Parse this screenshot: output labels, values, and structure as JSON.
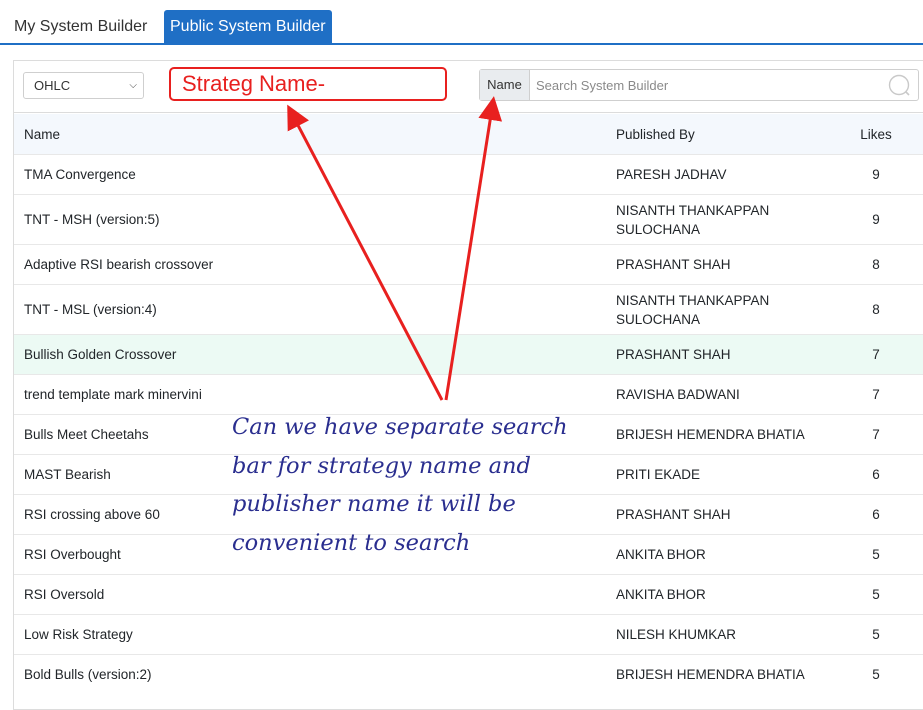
{
  "tabs": [
    {
      "label": "My System Builder",
      "active": false
    },
    {
      "label": "Public System Builder",
      "active": true
    }
  ],
  "filter": {
    "select_value": "OHLC",
    "annotation_box_text": "Strateg Name-",
    "search_label": "Name",
    "search_placeholder": "Search System Builder",
    "search_value": ""
  },
  "table": {
    "headers": {
      "name": "Name",
      "published_by": "Published By",
      "likes": "Likes"
    },
    "rows": [
      {
        "name": "TMA Convergence",
        "published_by": "PARESH JADHAV",
        "likes": "9"
      },
      {
        "name": "TNT - MSH (version:5)",
        "published_by": "NISANTH THANKAPPAN SULOCHANA",
        "likes": "9"
      },
      {
        "name": "Adaptive RSI bearish crossover",
        "published_by": "PRASHANT SHAH",
        "likes": "8"
      },
      {
        "name": "TNT - MSL (version:4)",
        "published_by": "NISANTH THANKAPPAN SULOCHANA",
        "likes": "8"
      },
      {
        "name": "Bullish Golden Crossover",
        "published_by": "PRASHANT SHAH",
        "likes": "7"
      },
      {
        "name": "trend template mark minervini",
        "published_by": "RAVISHA BADWANI",
        "likes": "7"
      },
      {
        "name": "Bulls Meet Cheetahs",
        "published_by": "BRIJESH HEMENDRA BHATIA",
        "likes": "7"
      },
      {
        "name": "MAST Bearish",
        "published_by": "PRITI EKADE",
        "likes": "6"
      },
      {
        "name": "RSI crossing above 60",
        "published_by": "PRASHANT SHAH",
        "likes": "6"
      },
      {
        "name": "RSI Overbought",
        "published_by": "ANKITA BHOR",
        "likes": "5"
      },
      {
        "name": "RSI Oversold",
        "published_by": "ANKITA BHOR",
        "likes": "5"
      },
      {
        "name": "Low Risk Strategy",
        "published_by": "NILESH KHUMKAR",
        "likes": "5"
      },
      {
        "name": "Bold Bulls (version:2)",
        "published_by": "BRIJESH HEMENDRA BHATIA",
        "likes": "5"
      }
    ]
  },
  "annotation": {
    "note_lines": [
      "Can we have separate search",
      "bar for strategy name and",
      "publisher name it will be",
      "convenient to search"
    ],
    "arrow_color": "#e8201f",
    "note_color": "#2a2e8f"
  },
  "colors": {
    "accent": "#1f6fc5",
    "header_bg": "#f4f8fd",
    "highlight_row_bg": "#ecfaf4"
  }
}
